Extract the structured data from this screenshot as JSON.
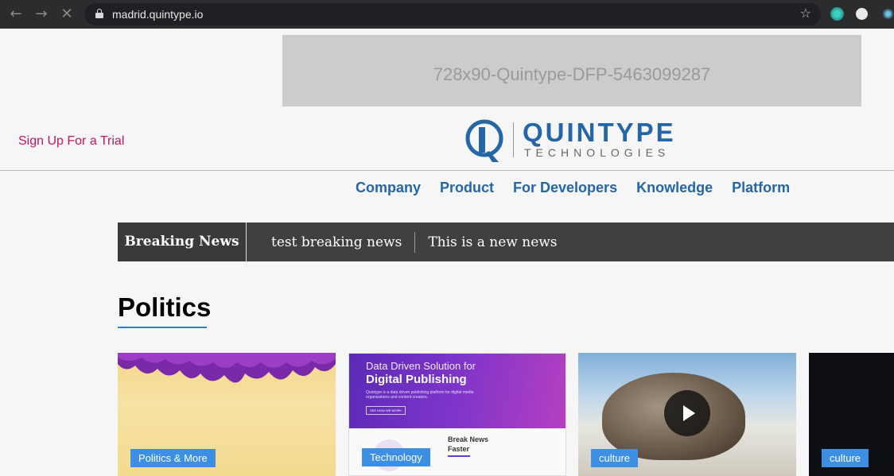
{
  "browser": {
    "url": "madrid.quintype.io",
    "back_icon": "←",
    "forward_icon": "→",
    "stop_icon": "✕",
    "star_icon": "☆"
  },
  "ad": {
    "label": "728x90-Quintype-DFP-5463099287"
  },
  "header": {
    "trial_link": "Sign Up For a Trial",
    "logo_name": "QUINTYPE",
    "logo_sub": "TECHNOLOGIES"
  },
  "nav": {
    "items": [
      "Company",
      "Product",
      "For Developers",
      "Knowledge",
      "Platform"
    ]
  },
  "breaking": {
    "label": "Breaking News",
    "items": [
      "test breaking news",
      "This is a new news"
    ]
  },
  "section": {
    "title": "Politics"
  },
  "cards": [
    {
      "tag": "Politics & More"
    },
    {
      "tag": "Technology",
      "hero_line1": "Data Driven Solution for",
      "hero_line2": "Digital Publishing",
      "hero_body": "Quintype is a data driven publishing platform for digital media organizations and content creators.",
      "hero_button": "SEE HOW WE WORK",
      "sub_line1": "Break News",
      "sub_line2": "Faster"
    },
    {
      "tag": "culture"
    },
    {
      "tag": "culture"
    }
  ],
  "colors": {
    "brand": "#2466a6",
    "trial": "#c2185b",
    "tag_bg": "#3d8fe3",
    "breaking_bg": "#404040"
  }
}
